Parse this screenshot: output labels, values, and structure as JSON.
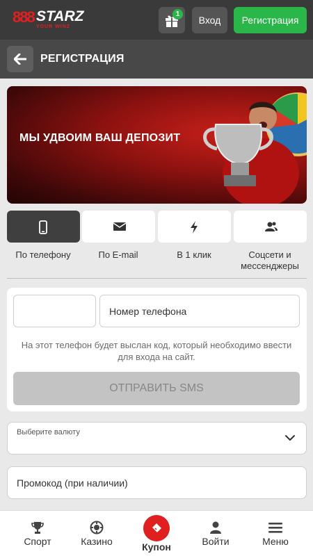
{
  "header": {
    "logo_digits": "888",
    "logo_name": "STARZ",
    "logo_tagline": "YOUR WINZ",
    "gift_badge_count": "1",
    "login_label": "Вход",
    "register_label": "Регистрация",
    "accent_color": "#2bb64a",
    "brand_red": "#e02020"
  },
  "page": {
    "title": "РЕГИСТРАЦИЯ"
  },
  "banner": {
    "headline": "МЫ УДВОИМ ВАШ ДЕПОЗИТ"
  },
  "methods": [
    {
      "label": "По телефону",
      "icon": "phone-icon",
      "active": true
    },
    {
      "label": "По E-mail",
      "icon": "envelope-icon",
      "active": false
    },
    {
      "label": "В 1 клик",
      "icon": "lightning-icon",
      "active": false
    },
    {
      "label": "Соцсети и мессенджеры",
      "icon": "users-icon",
      "active": false
    }
  ],
  "form": {
    "country_value": "",
    "phone_placeholder": "Номер телефона",
    "hint": "На этот телефон будет выслан код, который необходимо ввести для входа на сайт.",
    "send_sms_label": "ОТПРАВИТЬ SMS"
  },
  "currency": {
    "label": "Выберите валюту",
    "value": ""
  },
  "promo": {
    "placeholder": "Промокод (при наличии)"
  },
  "bottom_nav": {
    "sport": "Спорт",
    "casino": "Казино",
    "coupon": "Купон",
    "login": "Войти",
    "menu": "Меню"
  }
}
